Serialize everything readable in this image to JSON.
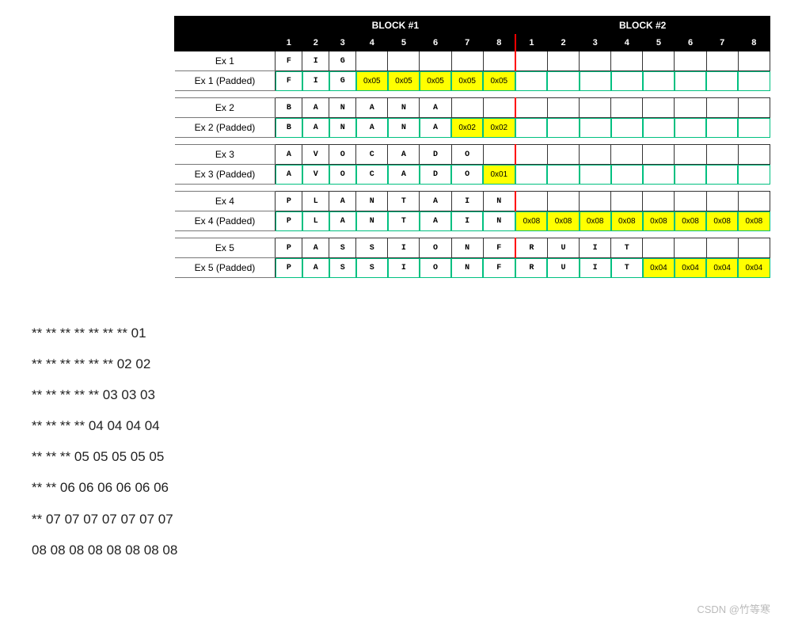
{
  "header": {
    "block1": "BLOCK #1",
    "block2": "BLOCK #2",
    "cols": [
      "1",
      "2",
      "3",
      "4",
      "5",
      "6",
      "7",
      "8"
    ]
  },
  "rows": [
    {
      "label": "Ex 1",
      "cells": [
        "F",
        "I",
        "G",
        "",
        "",
        "",
        "",
        "",
        "",
        "",
        "",
        "",
        "",
        "",
        "",
        ""
      ],
      "pad": []
    },
    {
      "label": "Ex 1 (Padded)",
      "cells": [
        "F",
        "I",
        "G",
        "0x05",
        "0x05",
        "0x05",
        "0x05",
        "0x05",
        "",
        "",
        "",
        "",
        "",
        "",
        "",
        ""
      ],
      "pad": [
        3,
        4,
        5,
        6,
        7
      ],
      "green": true
    },
    {
      "spacer": true
    },
    {
      "label": "Ex 2",
      "cells": [
        "B",
        "A",
        "N",
        "A",
        "N",
        "A",
        "",
        "",
        "",
        "",
        "",
        "",
        "",
        "",
        "",
        ""
      ],
      "pad": []
    },
    {
      "label": "Ex 2 (Padded)",
      "cells": [
        "B",
        "A",
        "N",
        "A",
        "N",
        "A",
        "0x02",
        "0x02",
        "",
        "",
        "",
        "",
        "",
        "",
        "",
        ""
      ],
      "pad": [
        6,
        7
      ],
      "green": true
    },
    {
      "spacer": true
    },
    {
      "label": "Ex 3",
      "cells": [
        "A",
        "V",
        "O",
        "C",
        "A",
        "D",
        "O",
        "",
        "",
        "",
        "",
        "",
        "",
        "",
        "",
        ""
      ],
      "pad": []
    },
    {
      "label": "Ex 3 (Padded)",
      "cells": [
        "A",
        "V",
        "O",
        "C",
        "A",
        "D",
        "O",
        "0x01",
        "",
        "",
        "",
        "",
        "",
        "",
        "",
        ""
      ],
      "pad": [
        7
      ],
      "green": true
    },
    {
      "spacer": true
    },
    {
      "label": "Ex 4",
      "cells": [
        "P",
        "L",
        "A",
        "N",
        "T",
        "A",
        "I",
        "N",
        "",
        "",
        "",
        "",
        "",
        "",
        "",
        ""
      ],
      "pad": []
    },
    {
      "label": "Ex 4 (Padded)",
      "cells": [
        "P",
        "L",
        "A",
        "N",
        "T",
        "A",
        "I",
        "N",
        "0x08",
        "0x08",
        "0x08",
        "0x08",
        "0x08",
        "0x08",
        "0x08",
        "0x08"
      ],
      "pad": [
        8,
        9,
        10,
        11,
        12,
        13,
        14,
        15
      ],
      "green": true
    },
    {
      "spacer": true
    },
    {
      "label": "Ex 5",
      "cells": [
        "P",
        "A",
        "S",
        "S",
        "I",
        "O",
        "N",
        "F",
        "R",
        "U",
        "I",
        "T",
        "",
        "",
        "",
        ""
      ],
      "pad": []
    },
    {
      "label": "Ex 5 (Padded)",
      "cells": [
        "P",
        "A",
        "S",
        "S",
        "I",
        "O",
        "N",
        "F",
        "R",
        "U",
        "I",
        "T",
        "0x04",
        "0x04",
        "0x04",
        "0x04"
      ],
      "pad": [
        12,
        13,
        14,
        15
      ],
      "green": true
    }
  ],
  "patterns": [
    "** ** ** ** ** ** ** 01",
    "** ** ** ** ** ** 02 02",
    "** ** ** ** ** 03 03 03",
    "** ** ** ** 04 04 04 04",
    "** ** ** 05 05 05 05 05",
    "** ** 06 06 06 06 06 06",
    "** 07 07 07 07 07 07 07",
    "08 08 08 08 08 08 08 08"
  ],
  "watermark": "CSDN @竹等寒"
}
